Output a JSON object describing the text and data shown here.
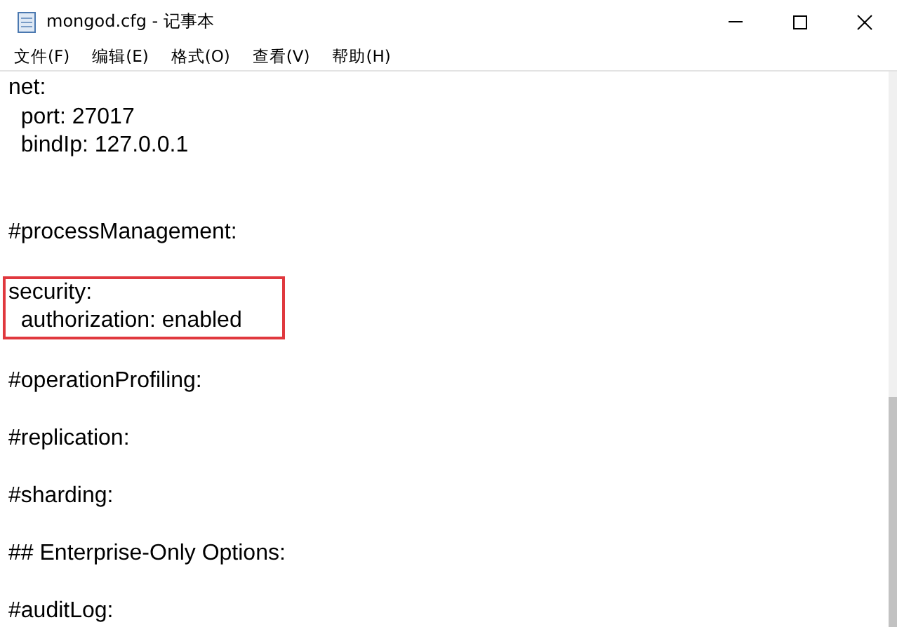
{
  "window": {
    "title": "mongod.cfg - 记事本"
  },
  "menu": [
    "文件(F)",
    "编辑(E)",
    "格式(O)",
    "查看(V)",
    "帮助(H)"
  ],
  "editor": {
    "items": [
      {
        "kind": "line",
        "text": "net:"
      },
      {
        "kind": "line",
        "text": "  port: 27017"
      },
      {
        "kind": "line",
        "text": "  bindIp: 127.0.0.1"
      },
      {
        "kind": "blank"
      },
      {
        "kind": "blank"
      },
      {
        "kind": "line",
        "text": "#processManagement:"
      },
      {
        "kind": "blank"
      },
      {
        "kind": "boxed",
        "lines": [
          "security:",
          "  authorization: enabled"
        ]
      },
      {
        "kind": "blank"
      },
      {
        "kind": "line",
        "text": "#operationProfiling:"
      },
      {
        "kind": "blank"
      },
      {
        "kind": "line",
        "text": "#replication:"
      },
      {
        "kind": "blank"
      },
      {
        "kind": "line",
        "text": "#sharding:"
      },
      {
        "kind": "blank"
      },
      {
        "kind": "line",
        "text": "## Enterprise-Only Options:"
      },
      {
        "kind": "blank"
      },
      {
        "kind": "line",
        "text": "#auditLog:"
      }
    ]
  }
}
